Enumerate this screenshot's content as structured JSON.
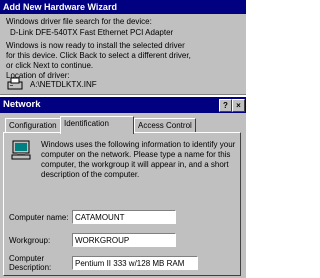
{
  "wizard": {
    "title": "Add New Hardware Wizard",
    "line1": "Windows driver file search for the device:",
    "device": "D-Link DFE-540TX Fast Ethernet PCI Adapter",
    "msg1": "Windows is now ready to install the selected driver",
    "msg2": "for this device. Click Back to select a different driver,",
    "msg3": "or click Next to continue.",
    "location_label": "Location of driver:",
    "driver_path": "A:\\NETDLKTX.INF"
  },
  "network": {
    "title": "Network",
    "help_btn": "?",
    "close_btn": "×",
    "tabs": [
      {
        "label": "Configuration"
      },
      {
        "label": "Identification"
      },
      {
        "label": "Access Control"
      }
    ],
    "description": "Windows uses the following information to identify your computer on the network. Please type a name for this computer, the workgroup it will appear in, and a short description of the computer.",
    "fields": {
      "computer_name": {
        "label": "Computer name:",
        "value": "CATAMOUNT"
      },
      "workgroup": {
        "label": "Workgroup:",
        "value": "WORKGROUP"
      },
      "description": {
        "label1": "Computer",
        "label2": "Description:",
        "value": "Pentium II 333 w/128 MB RAM"
      }
    }
  },
  "colors": {
    "title_bar": "#000080",
    "face": "#c0c0c0"
  }
}
